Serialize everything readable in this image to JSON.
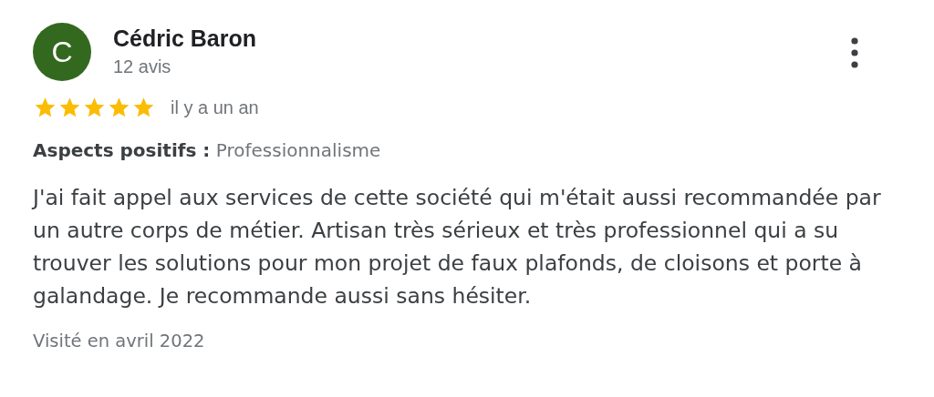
{
  "review": {
    "author": "Cédric Baron",
    "avatar_letter": "C",
    "review_count": "12 avis",
    "stars": 5,
    "time": "il y a un an",
    "aspects_label": "Aspects positifs :",
    "aspects_value": "Professionnalisme",
    "text": "J'ai fait appel aux services de cette société qui m'était aussi recommandée par un autre corps de métier. Artisan très sérieux et très professionnel qui a su trouver les solutions pour mon projet de faux plafonds, de cloisons et porte à galandage. Je recommande aussi sans hésiter.",
    "visited": "Visité en avril 2022"
  }
}
